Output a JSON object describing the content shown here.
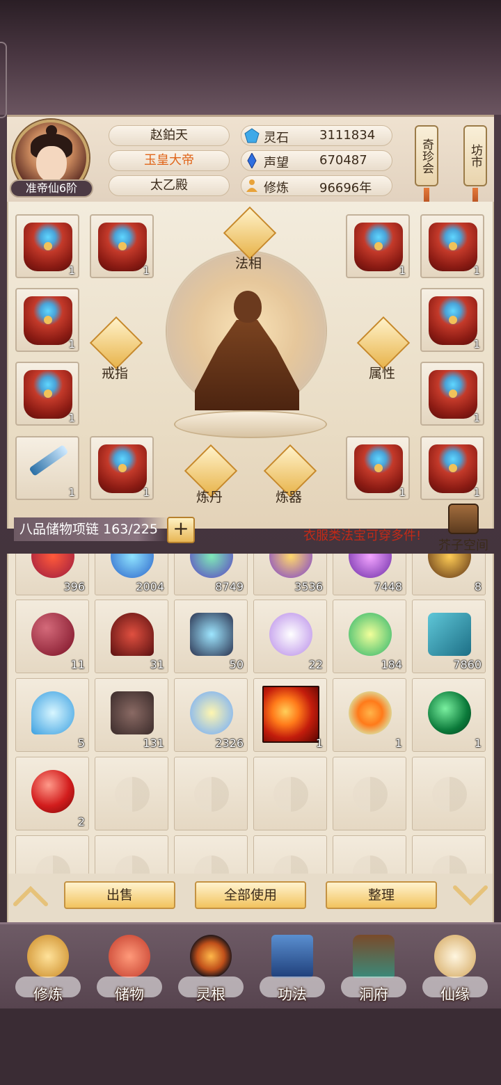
{
  "player": {
    "name": "赵鉑天",
    "title": "玉皇大帝",
    "palace": "太乙殿",
    "rank": "准帝仙6阶"
  },
  "stats": [
    {
      "label": "灵石",
      "value": "3111834",
      "icon": "spirit-stone-icon",
      "color": "#3fa9e8"
    },
    {
      "label": "声望",
      "value": "670487",
      "icon": "reputation-crystal-icon",
      "color": "#2f6fe0"
    },
    {
      "label": "修炼",
      "value": "96696年",
      "icon": "meditation-icon",
      "color": "#e8a33a"
    }
  ],
  "side_buttons": {
    "treasure": "奇珍会",
    "market": "坊市"
  },
  "equipment": {
    "slots": [
      "1",
      "1",
      "1",
      "1",
      "1",
      "1",
      "1",
      "1",
      "1",
      "1",
      "1",
      "1"
    ],
    "labels": {
      "faxiang": "法相",
      "ring": "戒指",
      "attributes": "属性",
      "alchemy": "炼丹",
      "forging": "炼器"
    }
  },
  "storage": {
    "name": "八品储物项链 163/225",
    "plus": "+",
    "notice": "衣服类法宝可穿多件!",
    "space_label": "芥子空间"
  },
  "inventory": {
    "row0": [
      "396",
      "2004",
      "8749",
      "3536",
      "7448",
      "8"
    ],
    "row1": [
      "11",
      "31",
      "50",
      "22",
      "184",
      "7860"
    ],
    "row2": [
      "5",
      "131",
      "2326",
      "1",
      "1",
      "1"
    ],
    "row3": [
      "2"
    ]
  },
  "actions": {
    "sell": "出售",
    "use_all": "全部使用",
    "sort": "整理"
  },
  "nav": [
    "修炼",
    "储物",
    "灵根",
    "功法",
    "洞府",
    "仙缘"
  ]
}
